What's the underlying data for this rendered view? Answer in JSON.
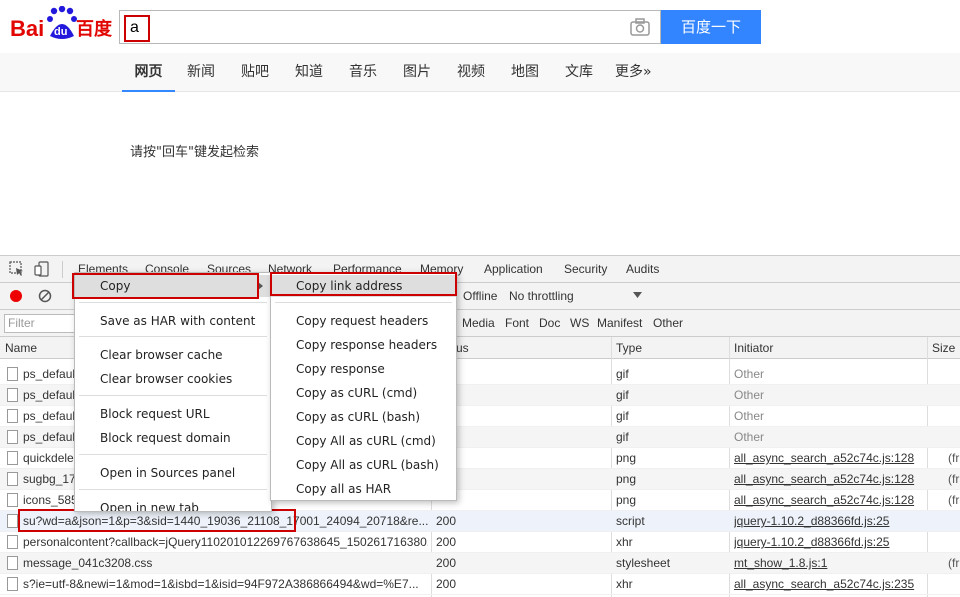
{
  "baidu": {
    "logo_text_left": "Bai",
    "logo_paw_text": "du",
    "logo_text_right": "百度",
    "search_value": "a",
    "search_button": "百度一下",
    "nav": [
      "网页",
      "新闻",
      "贴吧",
      "知道",
      "音乐",
      "图片",
      "视频",
      "地图",
      "文库",
      "更多»"
    ],
    "hint": "请按\"回车\"键发起检索",
    "colors": {
      "brand_red": "#e10602",
      "brand_blue": "#2319dc",
      "button_blue": "#3385ff"
    }
  },
  "devtools": {
    "tabs": [
      "Elements",
      "Console",
      "Sources",
      "Network",
      "Performance",
      "Memory",
      "Application",
      "Security",
      "Audits"
    ],
    "toolbar": {
      "offline": "Offline",
      "throttling": "No throttling"
    },
    "filter_placeholder": "Filter",
    "type_filters": [
      "Media",
      "Font",
      "Doc",
      "WS",
      "Manifest",
      "Other"
    ],
    "columns": {
      "name": "Name",
      "status": "us",
      "type": "Type",
      "initiator": "Initiator",
      "size": "Size"
    },
    "rows": [
      {
        "name": "ps_defaul",
        "status": "",
        "type": "gif",
        "initiator": "Other",
        "size": ""
      },
      {
        "name": "ps_defaul",
        "status": "",
        "type": "gif",
        "initiator": "Other",
        "size": ""
      },
      {
        "name": "ps_defaul",
        "status": "",
        "type": "gif",
        "initiator": "Other",
        "size": ""
      },
      {
        "name": "ps_defaul",
        "status": "",
        "type": "gif",
        "initiator": "Other",
        "size": ""
      },
      {
        "name": "quickdele",
        "status": "",
        "type": "png",
        "initiator": "all_async_search_a52c74c.js:128",
        "size": "(fr"
      },
      {
        "name": "sugbg_17",
        "status": "",
        "type": "png",
        "initiator": "all_async_search_a52c74c.js:128",
        "size": "(fr"
      },
      {
        "name": "icons_585",
        "status": "",
        "type": "png",
        "initiator": "all_async_search_a52c74c.js:128",
        "size": "(fr"
      },
      {
        "name": "su?wd=a&json=1&p=3&sid=1440_19036_21108_17001_24094_20718&re...",
        "status": "200",
        "type": "script",
        "initiator": "jquery-1.10.2_d88366fd.js:25",
        "size": ""
      },
      {
        "name": "personalcontent?callback=jQuery110201012269767638645_150261716380...",
        "status": "200",
        "type": "xhr",
        "initiator": "jquery-1.10.2_d88366fd.js:25",
        "size": ""
      },
      {
        "name": "message_041c3208.css",
        "status": "200",
        "type": "stylesheet",
        "initiator": "mt_show_1.8.js:1",
        "size": "(fr"
      },
      {
        "name": "s?ie=utf-8&newi=1&mod=1&isbd=1&isid=94F972A386866494&wd=%E7...",
        "status": "200",
        "type": "xhr",
        "initiator": "all_async_search_a52c74c.js:235",
        "size": ""
      }
    ]
  },
  "context_menu": {
    "items": [
      "Copy",
      "Save as HAR with content",
      "Clear browser cache",
      "Clear browser cookies",
      "Block request URL",
      "Block request domain",
      "Open in Sources panel",
      "Open in new tab"
    ],
    "copy_submenu": [
      "Copy link address",
      "Copy request headers",
      "Copy response headers",
      "Copy response",
      "Copy as cURL (cmd)",
      "Copy as cURL (bash)",
      "Copy All as cURL (cmd)",
      "Copy All as cURL (bash)",
      "Copy all as HAR"
    ]
  }
}
